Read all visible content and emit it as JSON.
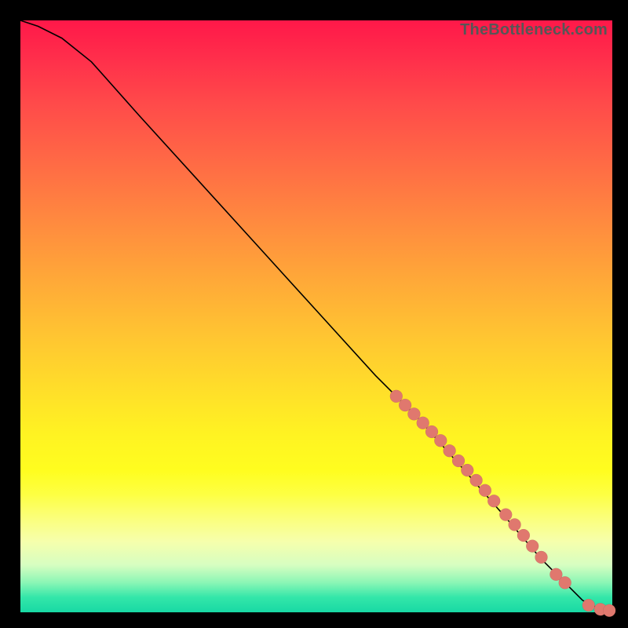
{
  "watermark": "TheBottleneck.com",
  "colors": {
    "bg": "#000000",
    "marker": "#e0786e",
    "curve": "#000000"
  },
  "chart_data": {
    "type": "line",
    "title": "",
    "xlabel": "",
    "ylabel": "",
    "xlim": [
      0,
      100
    ],
    "ylim": [
      0,
      100
    ],
    "grid": false,
    "series": [
      {
        "name": "curve",
        "x": [
          0,
          3,
          7,
          12,
          20,
          30,
          40,
          50,
          60,
          67,
          75,
          82,
          88,
          92,
          95,
          97,
          99,
          100
        ],
        "y": [
          100,
          99,
          97,
          93,
          84,
          73,
          62,
          51,
          40,
          33,
          24,
          16,
          9,
          5,
          2,
          1,
          0.3,
          0.2
        ]
      }
    ],
    "markers": {
      "name": "highlighted-points",
      "x": [
        63.5,
        65,
        66.5,
        68,
        69.5,
        71,
        72.5,
        74,
        75.5,
        77,
        78.5,
        80,
        82,
        83.5,
        85,
        86.5,
        88,
        90.5,
        92,
        96,
        98,
        99.5
      ],
      "y": [
        36.5,
        35,
        33.5,
        32,
        30.5,
        29,
        27.3,
        25.6,
        24,
        22.3,
        20.6,
        18.8,
        16.5,
        14.8,
        13,
        11.2,
        9.3,
        6.4,
        5,
        1.2,
        0.5,
        0.3
      ]
    }
  }
}
